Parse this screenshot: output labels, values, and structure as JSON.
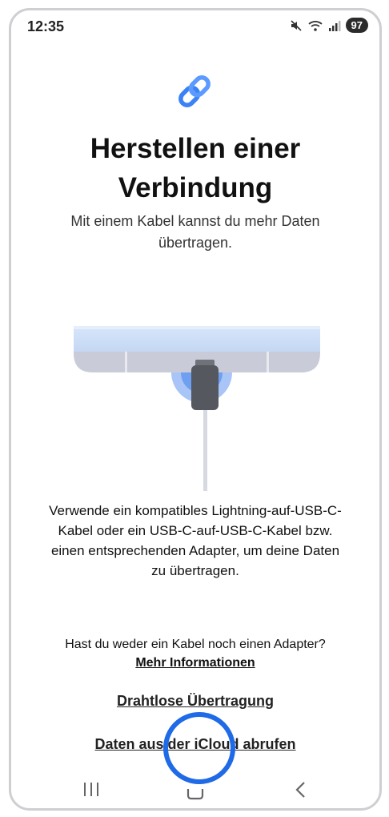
{
  "status_bar": {
    "time": "12:35",
    "battery": "97",
    "icons": [
      "mute-icon",
      "wifi-icon",
      "signal-icon"
    ]
  },
  "header": {
    "icon": "link-icon",
    "title_line1": "Herstellen einer",
    "title_line2": "Verbindung",
    "subtitle": "Mit einem Kabel kannst du mehr Daten übertragen."
  },
  "illustration": {
    "icon": "phone-cable-illustration"
  },
  "body": {
    "description": "Verwende ein kompatibles Lightning-auf-USB-C-Kabel oder ein USB-C-auf-USB-C-Kabel bzw. einen entsprechenden Adapter, um deine Daten zu übertragen.",
    "question": "Hast du weder ein Kabel noch einen Adapter?",
    "more_info_link": "Mehr Informationen"
  },
  "actions": {
    "wireless_label": "Drahtlose Übertragung",
    "icloud_label": "Daten aus der iCloud abrufen"
  },
  "navbar": {
    "icons": [
      "recents-icon",
      "home-icon",
      "back-icon"
    ]
  },
  "colors": {
    "accent": "#1f6ae6",
    "link_icon": "#3b82f6",
    "text": "#111111"
  }
}
